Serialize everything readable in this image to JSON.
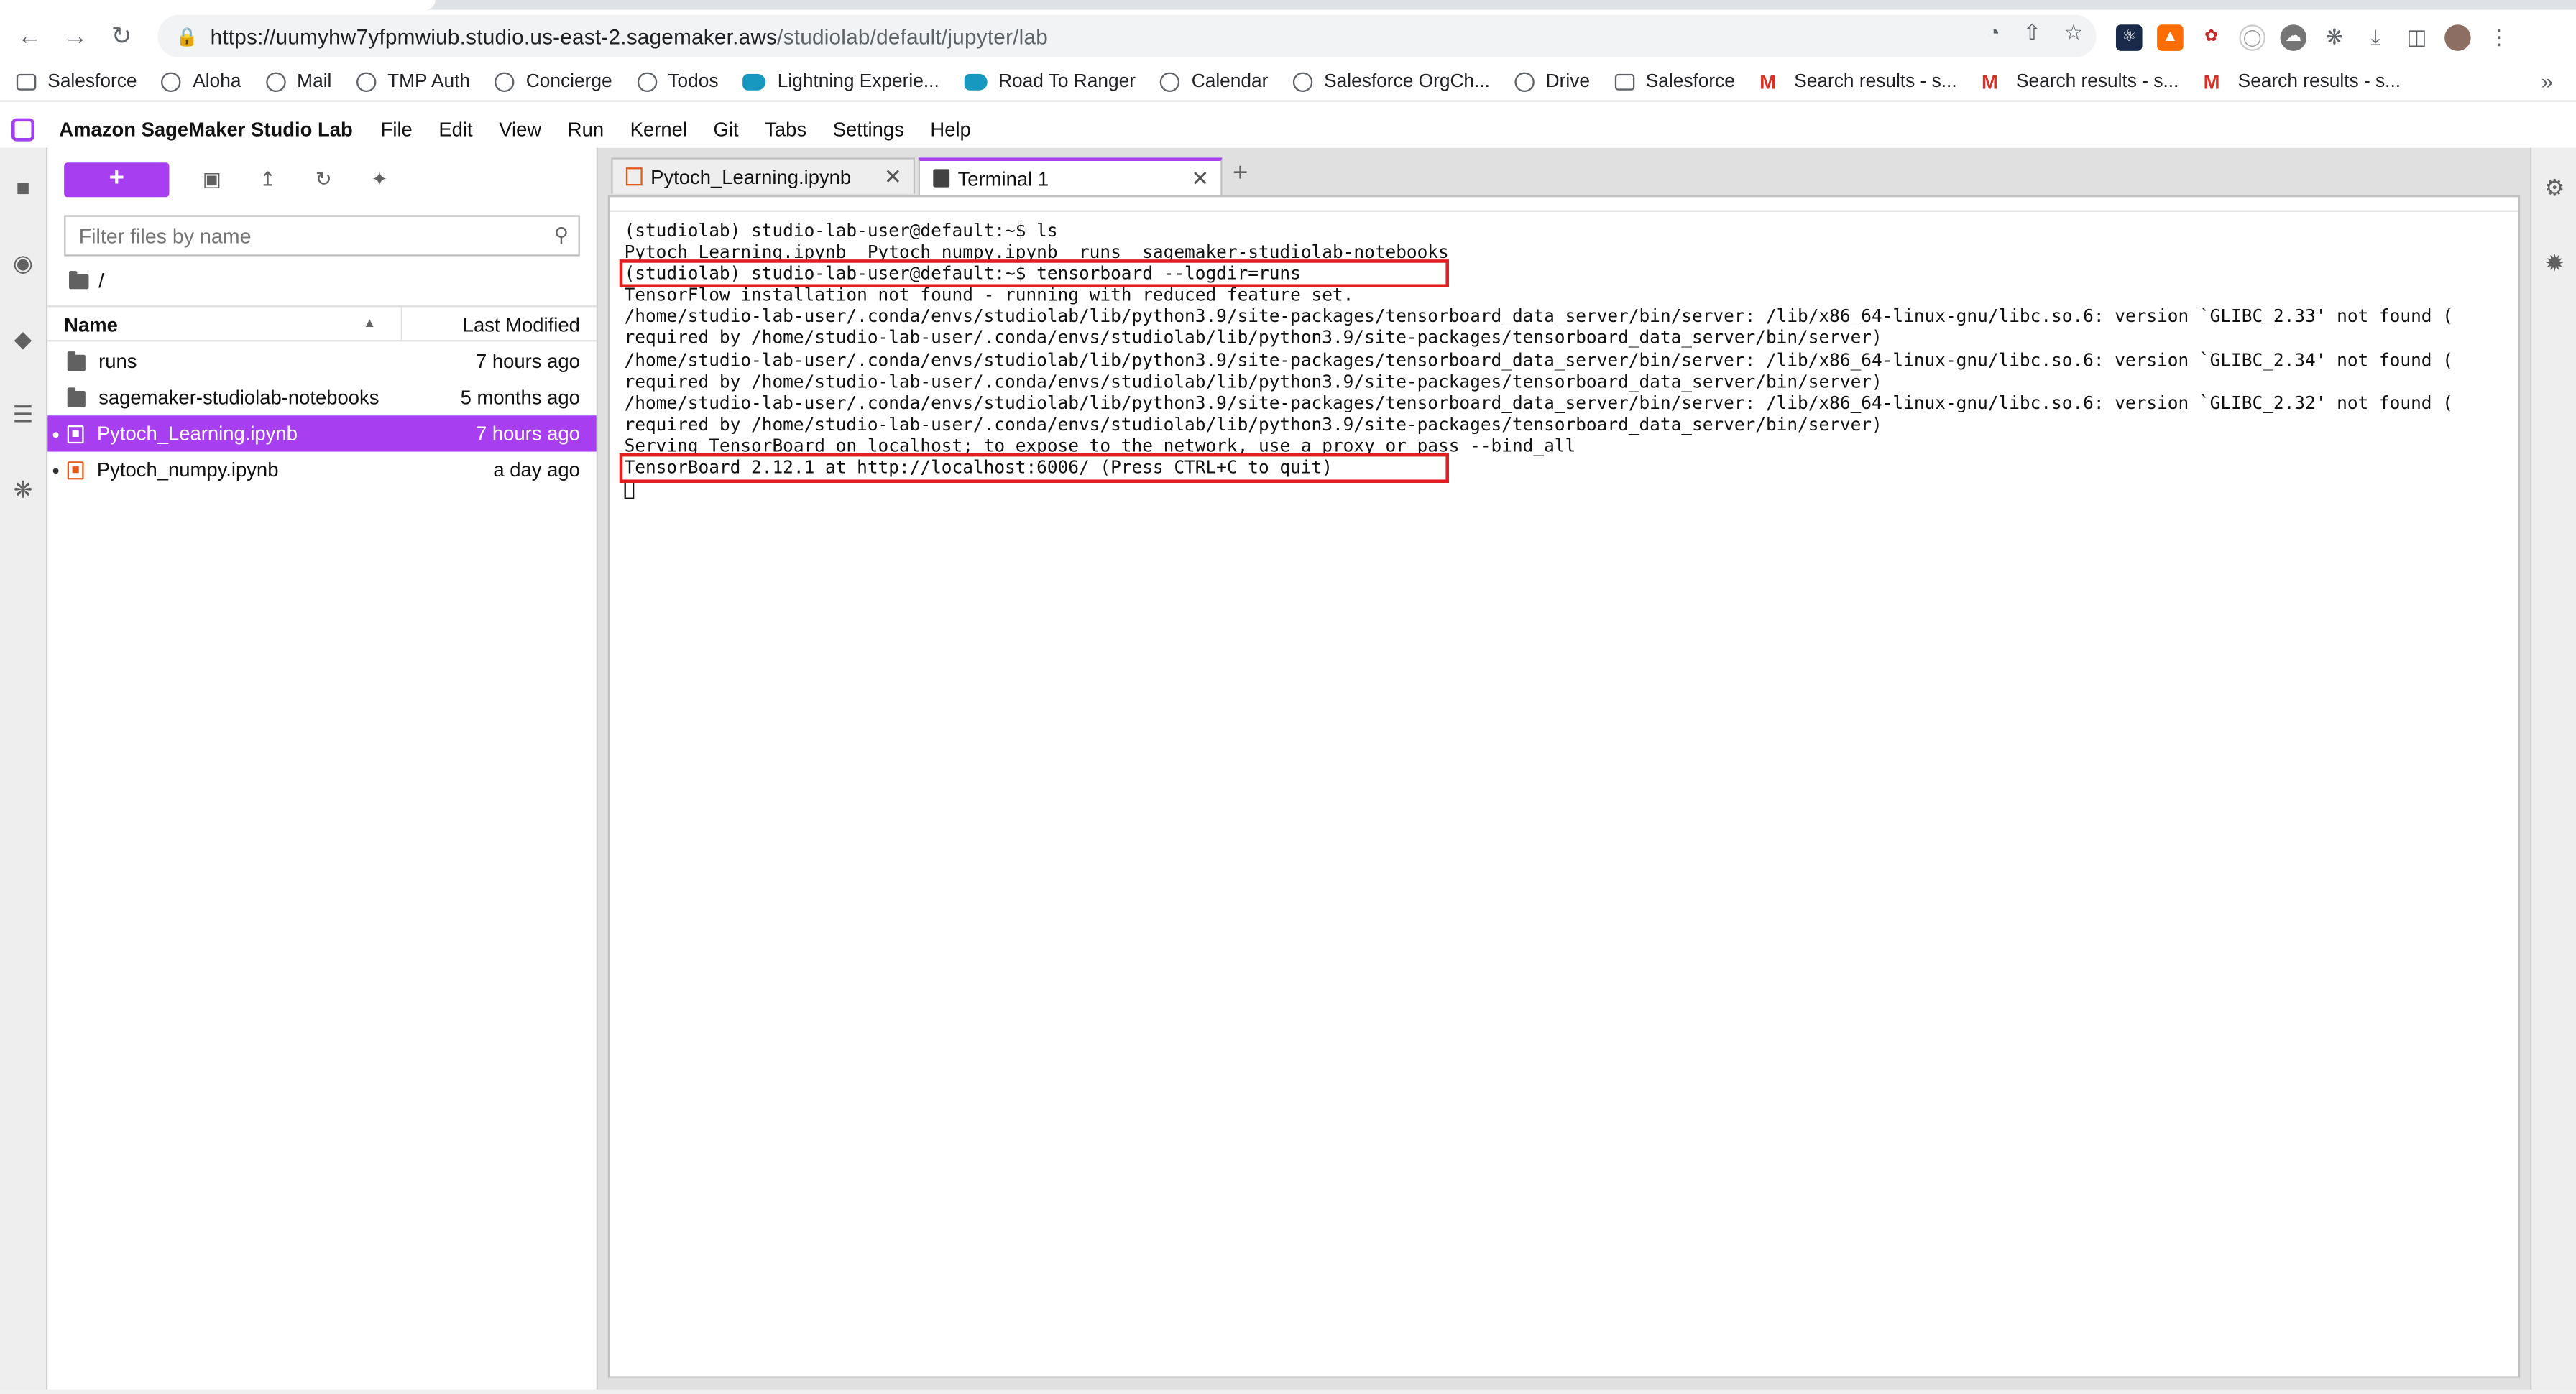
{
  "browser": {
    "url_host": "https://uumyhw7yfpmwiub.studio.us-east-2.sagemaker.aws",
    "url_path": "/studiolab/default/jupyter/lab",
    "bookmarks": [
      "Salesforce",
      "Aloha",
      "Mail",
      "TMP Auth",
      "Concierge",
      "Todos",
      "Lightning Experie...",
      "Road To Ranger",
      "Calendar",
      "Salesforce OrgCh...",
      "Drive",
      "Salesforce",
      "Search results - s...",
      "Search results - s...",
      "Search results - s..."
    ]
  },
  "app": {
    "title": "Amazon SageMaker Studio Lab",
    "menu": [
      "File",
      "Edit",
      "View",
      "Run",
      "Kernel",
      "Git",
      "Tabs",
      "Settings",
      "Help"
    ]
  },
  "filebrowser": {
    "new_label": "+",
    "filter_placeholder": "Filter files by name",
    "breadcrumb": "/",
    "col_name": "Name",
    "col_modified": "Last Modified",
    "items": [
      {
        "name": "runs",
        "modified": "7 hours ago"
      },
      {
        "name": "sagemaker-studiolab-notebooks",
        "modified": "5 months ago"
      },
      {
        "name": "Pytoch_Learning.ipynb",
        "modified": "7 hours ago"
      },
      {
        "name": "Pytoch_numpy.ipynb",
        "modified": "a day ago"
      }
    ]
  },
  "tabs": [
    {
      "label": "Pytoch_Learning.ipynb"
    },
    {
      "label": "Terminal 1"
    }
  ],
  "terminal": {
    "lines": [
      "(studiolab) studio-lab-user@default:~$ ls",
      "Pytoch_Learning.ipynb  Pytoch_numpy.ipynb  runs  sagemaker-studiolab-notebooks",
      "(studiolab) studio-lab-user@default:~$ tensorboard --logdir=runs",
      "TensorFlow installation not found - running with reduced feature set.",
      "/home/studio-lab-user/.conda/envs/studiolab/lib/python3.9/site-packages/tensorboard_data_server/bin/server: /lib/x86_64-linux-gnu/libc.so.6: version `GLIBC_2.33' not found (",
      "required by /home/studio-lab-user/.conda/envs/studiolab/lib/python3.9/site-packages/tensorboard_data_server/bin/server)",
      "/home/studio-lab-user/.conda/envs/studiolab/lib/python3.9/site-packages/tensorboard_data_server/bin/server: /lib/x86_64-linux-gnu/libc.so.6: version `GLIBC_2.34' not found (",
      "required by /home/studio-lab-user/.conda/envs/studiolab/lib/python3.9/site-packages/tensorboard_data_server/bin/server)",
      "/home/studio-lab-user/.conda/envs/studiolab/lib/python3.9/site-packages/tensorboard_data_server/bin/server: /lib/x86_64-linux-gnu/libc.so.6: version `GLIBC_2.32' not found (",
      "required by /home/studio-lab-user/.conda/envs/studiolab/lib/python3.9/site-packages/tensorboard_data_server/bin/server)",
      "Serving TensorBoard on localhost; to expose to the network, use a proxy or pass --bind_all",
      "TensorBoard 2.12.1 at http://localhost:6006/ (Press CTRL+C to quit)"
    ]
  },
  "colors": {
    "accent": "#a73ff0",
    "highlight": "#e02020"
  }
}
